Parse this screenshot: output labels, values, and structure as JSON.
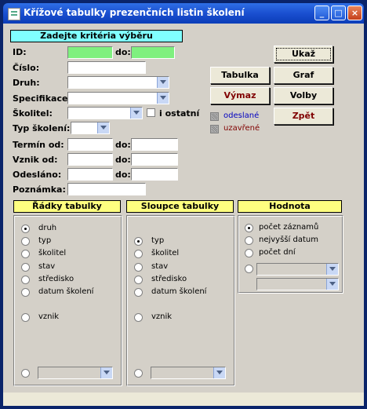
{
  "window": {
    "title": "Křížové tabulky prezenčních listin školení",
    "buttons": [
      "minimize-icon",
      "maximize-icon",
      "close-icon"
    ]
  },
  "criteria": {
    "header": "Zadejte kritéria výběru",
    "id_label": "ID:",
    "do_label": "do:",
    "cislo_label": "Číslo:",
    "druh_label": "Druh:",
    "specifikace_label": "Specifikace:",
    "skolitel_label": "Školitel:",
    "i_ostatni_label": "i ostatní",
    "typ_skoleni_label": "Typ školení:",
    "termin_label": "Termín od:",
    "vznik_label": "Vznik od:",
    "odeslano_label": "Odesláno:",
    "poznamka_label": "Poznámka:"
  },
  "buttons": {
    "ukaz": "Ukaž",
    "tabulka": "Tabulka",
    "graf": "Graf",
    "vymaz": "Výmaz",
    "volby": "Volby",
    "zpet": "Zpět"
  },
  "checkboxes": {
    "odeslane": "odeslané",
    "uzavrene": "uzavřené"
  },
  "colors": {
    "odeslane": "#0000c0",
    "uzavrene": "#800000",
    "criteria_header": "#80ffff",
    "section_header": "#ffff80",
    "id_field": "#7ff07f"
  },
  "rows": {
    "header": "Řádky tabulky",
    "options": [
      "druh",
      "typ",
      "školitel",
      "stav",
      "středisko",
      "datum školení",
      "vznik"
    ],
    "selected": "druh"
  },
  "columns": {
    "header": "Sloupce tabulky",
    "options": [
      "typ",
      "školitel",
      "stav",
      "středisko",
      "datum školení",
      "vznik"
    ],
    "selected": "typ"
  },
  "value": {
    "header": "Hodnota",
    "options": [
      "počet záznamů",
      "nejvyšší datum",
      "počet dní"
    ],
    "selected": "počet záznamů"
  }
}
